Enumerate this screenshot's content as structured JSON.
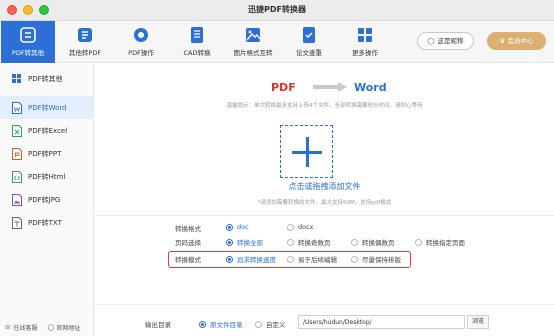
{
  "window": {
    "title": "迅捷PDF转换器"
  },
  "toolbar": {
    "tools": [
      {
        "label": "PDF转其他",
        "icon": "pdf-convert-icon",
        "active": true
      },
      {
        "label": "其他转PDF",
        "icon": "other-to-pdf-icon",
        "active": false
      },
      {
        "label": "PDF操作",
        "icon": "gear-icon",
        "active": false
      },
      {
        "label": "CAD转换",
        "icon": "cad-icon",
        "active": false
      },
      {
        "label": "图片格式互转",
        "icon": "image-icon",
        "active": false
      },
      {
        "label": "论文查重",
        "icon": "document-check-icon",
        "active": false
      },
      {
        "label": "更多操作",
        "icon": "grid-icon",
        "active": false
      }
    ],
    "user_label": "这是昵称",
    "vip_label": "会员中心"
  },
  "sidebar": {
    "header": "PDF转其他",
    "items": [
      {
        "label": "PDF转Word",
        "active": true,
        "color": "#2b6fd7"
      },
      {
        "label": "PDF转Excel",
        "active": false,
        "color": "#2e9e5a"
      },
      {
        "label": "PDF转PPT",
        "active": false,
        "color": "#e05a2a"
      },
      {
        "label": "PDF转Html",
        "active": false,
        "color": "#3fa45b"
      },
      {
        "label": "PDF转JPG",
        "active": false,
        "color": "#7a52c7"
      },
      {
        "label": "PDF转TXT",
        "active": false,
        "color": "#5a6b7d"
      }
    ],
    "footer": {
      "service": "在线客服",
      "website": "官网地址"
    }
  },
  "main": {
    "from_format": "PDF",
    "to_format": "Word",
    "hint": "温馨提示：单次转换最多支持上传4个文件，全部转换需要较长时间，请耐心等待",
    "add_label": "点击或拖拽添加文件",
    "sub_hint": "*请添加需要转换的文件，最大支持50M，支持pdf格式"
  },
  "options": {
    "format": {
      "label": "转换格式",
      "choices": [
        "doc",
        "docx"
      ],
      "selected": 0
    },
    "pages": {
      "label": "页码选择",
      "choices": [
        "转换全部",
        "转换奇数页",
        "转换偶数页",
        "转换指定页面"
      ],
      "selected": 0
    },
    "mode": {
      "label": "转换模式",
      "choices": [
        "追求转换速度",
        "易于后续编辑",
        "尽量保持排版"
      ],
      "selected": 0
    }
  },
  "output": {
    "label": "输出目录",
    "choices": [
      "原文件目录",
      "自定义"
    ],
    "selected": 0,
    "path": "/Users/hudun/Desktop/",
    "browse_label": "浏览"
  },
  "colors": {
    "accent": "#2b6fd7",
    "vip": "#dcb073",
    "highlight_box": "#e23b3b"
  }
}
